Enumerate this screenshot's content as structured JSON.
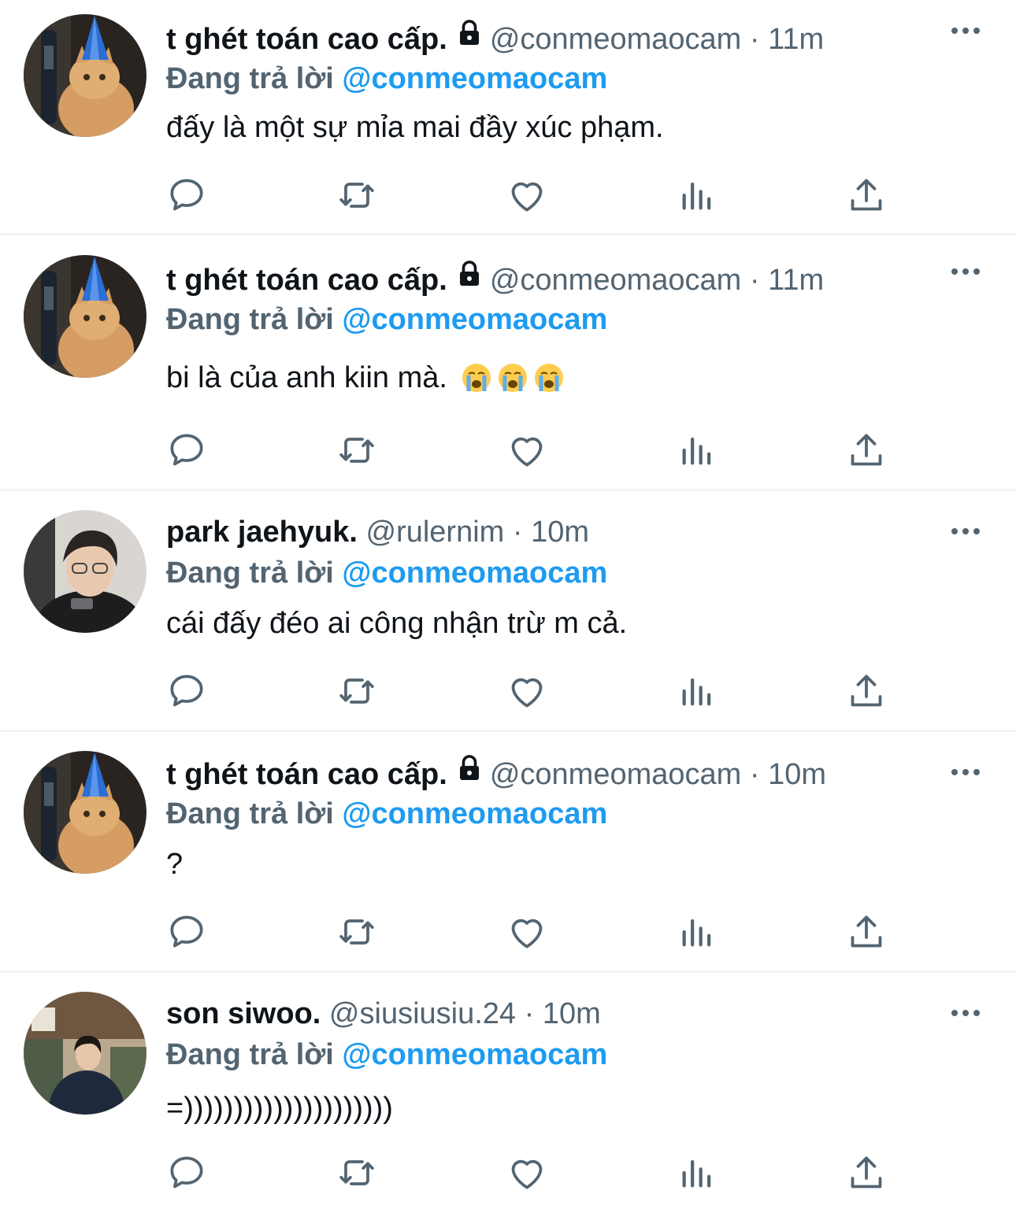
{
  "reply_prefix": "Đang trả lời",
  "colors": {
    "text": "#0f1419",
    "secondary": "#536471",
    "accent": "#1d9bf0",
    "divider": "#eff3f4"
  },
  "icons": [
    "reply-icon",
    "retweet-icon",
    "like-icon",
    "views-icon",
    "share-icon",
    "more-icon",
    "lock-icon"
  ],
  "tweets": [
    {
      "name": "t ghét toán cao cấp.",
      "locked": true,
      "handle": "@conmeomaocam",
      "dot": "·",
      "time": "11m",
      "reply_to": "@conmeomaocam",
      "text": "đấy là một sự mỉa mai đầy xúc phạm.",
      "emoji_count": 0
    },
    {
      "name": "t ghét toán cao cấp.",
      "locked": true,
      "handle": "@conmeomaocam",
      "dot": "·",
      "time": "11m",
      "reply_to": "@conmeomaocam",
      "text": "bi là của anh kiin mà.",
      "emoji": "😭",
      "emoji_count": 3
    },
    {
      "name": "park jaehyuk.",
      "locked": false,
      "handle": "@rulernim",
      "dot": "·",
      "time": "10m",
      "reply_to": "@conmeomaocam",
      "text": "cái đấy đéo ai công nhận trừ m cả.",
      "emoji_count": 0
    },
    {
      "name": "t ghét toán cao cấp.",
      "locked": true,
      "handle": "@conmeomaocam",
      "dot": "·",
      "time": "10m",
      "reply_to": "@conmeomaocam",
      "text": "?",
      "emoji_count": 0
    },
    {
      "name": "son siwoo.",
      "locked": false,
      "handle": "@siusiusiu.24",
      "dot": "·",
      "time": "10m",
      "reply_to": "@conmeomaocam",
      "text": "=)))))))))))))))))))))",
      "emoji_count": 0
    }
  ]
}
